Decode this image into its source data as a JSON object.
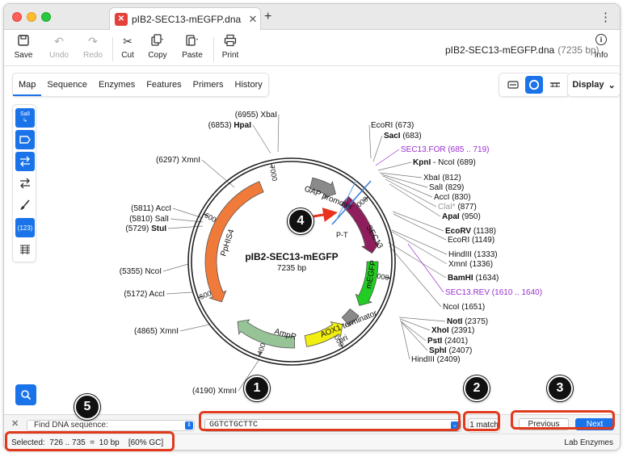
{
  "app": {
    "tab_title": "pIB2-SEC13-mEGFP.dna",
    "tab_icon": "snapgene-icon",
    "file_title": "pIB2-SEC13-mEGFP.dna",
    "file_size": "(7235 bp)"
  },
  "toolbar": {
    "save": "Save",
    "undo": "Undo",
    "redo": "Redo",
    "cut": "Cut",
    "copy": "Copy",
    "paste": "Paste",
    "print": "Print",
    "info": "Info"
  },
  "view_tabs": [
    "Map",
    "Sequence",
    "Enzymes",
    "Features",
    "Primers",
    "History"
  ],
  "display_label": "Display",
  "palette": {
    "sali_label": "SalI",
    "count_label": "(123)"
  },
  "plasmid": {
    "name": "pIB2-SEC13-mEGFP",
    "length": "7235 bp"
  },
  "ruler_ticks": [
    "1000",
    "2000",
    "3000",
    "4000",
    "5000",
    "6000",
    "7000"
  ],
  "features": {
    "gap_promoter": "GAP promoter",
    "sec13": "SEC13",
    "megfp": "mEGFP",
    "aox1": "AOX1 terminator",
    "ori": "ori",
    "ampr": "AmpR",
    "pphis4": "PpHIS4",
    "pt": "P-T"
  },
  "enzymes_right": [
    {
      "name": "EcoRI",
      "pos": "(673)",
      "bold": false
    },
    {
      "name": "SacI",
      "pos": "(683)",
      "bold": true
    },
    {
      "name": "SEC13.FOR",
      "pos": "(685 .. 719)",
      "primer": true
    },
    {
      "name": "KpnI",
      "extra": " - NcoI",
      "pos": "(689)",
      "bold": true
    },
    {
      "name": "XbaI",
      "pos": "(812)",
      "bold": false
    },
    {
      "name": "SalI",
      "pos": "(829)",
      "bold": false
    },
    {
      "name": "AccI",
      "pos": "(830)",
      "bold": false
    },
    {
      "name": "ClaI*",
      "pos": "(877)",
      "grey": true
    },
    {
      "name": "ApaI",
      "pos": "(950)",
      "bold": true
    },
    {
      "name": "EcoRV",
      "pos": "(1138)",
      "bold": true
    },
    {
      "name": "EcoRI",
      "pos": "(1149)",
      "bold": false
    },
    {
      "name": "HindIII",
      "pos": "(1333)",
      "bold": false
    },
    {
      "name": "XmnI",
      "pos": "(1336)",
      "bold": false
    },
    {
      "name": "BamHI",
      "pos": "(1634)",
      "bold": true
    },
    {
      "name": "SEC13.REV",
      "pos": "(1610 .. 1640)",
      "primer": true
    },
    {
      "name": "NcoI",
      "pos": "(1651)",
      "bold": false
    },
    {
      "name": "NotI",
      "pos": "(2375)",
      "bold": true
    },
    {
      "name": "XhoI",
      "pos": "(2391)",
      "bold": true
    },
    {
      "name": "PstI",
      "pos": "(2401)",
      "bold": true
    },
    {
      "name": "SphI",
      "pos": "(2407)",
      "bold": true
    },
    {
      "name": "HindIII",
      "pos": "(2409)",
      "bold": false
    }
  ],
  "enzymes_left": [
    {
      "name": "XbaI",
      "pos": "(6955)",
      "bold": false
    },
    {
      "name": "HpaI",
      "pos": "(6853)",
      "bold": true
    },
    {
      "name": "XmnI",
      "pos": "(6297)",
      "bold": false
    },
    {
      "name": "AccI",
      "pos": "(5811)",
      "bold": false
    },
    {
      "name": "SalI",
      "pos": "(5810)",
      "bold": false
    },
    {
      "name": "StuI",
      "pos": "(5729)",
      "bold": true
    },
    {
      "name": "NcoI",
      "pos": "(5355)",
      "bold": false
    },
    {
      "name": "AccI",
      "pos": "(5172)",
      "bold": false
    },
    {
      "name": "XmnI",
      "pos": "(4865)",
      "bold": false
    },
    {
      "name": "XmnI",
      "pos": "(4190)",
      "bold": false
    }
  ],
  "find": {
    "mode": "Find DNA sequence:",
    "query": "GGTCTGCTTC",
    "matches": "1 match",
    "previous": "Previous",
    "next": "Next"
  },
  "status": {
    "selection": "Selected:  726 .. 735  =  10 bp    [60% GC]",
    "right": "Lab Enzymes"
  },
  "callouts": [
    "1",
    "2",
    "3",
    "4",
    "5"
  ],
  "colors": {
    "accent": "#1a73e8",
    "highlight": "#e03a1e",
    "primer": "#9b2ecf",
    "gap_promoter": "#8a8a8a",
    "sec13": "#8e1f5c",
    "megfp": "#22cc22",
    "ori": "#f2ee10",
    "ampr": "#96c496",
    "pphis4": "#f07a3a"
  }
}
